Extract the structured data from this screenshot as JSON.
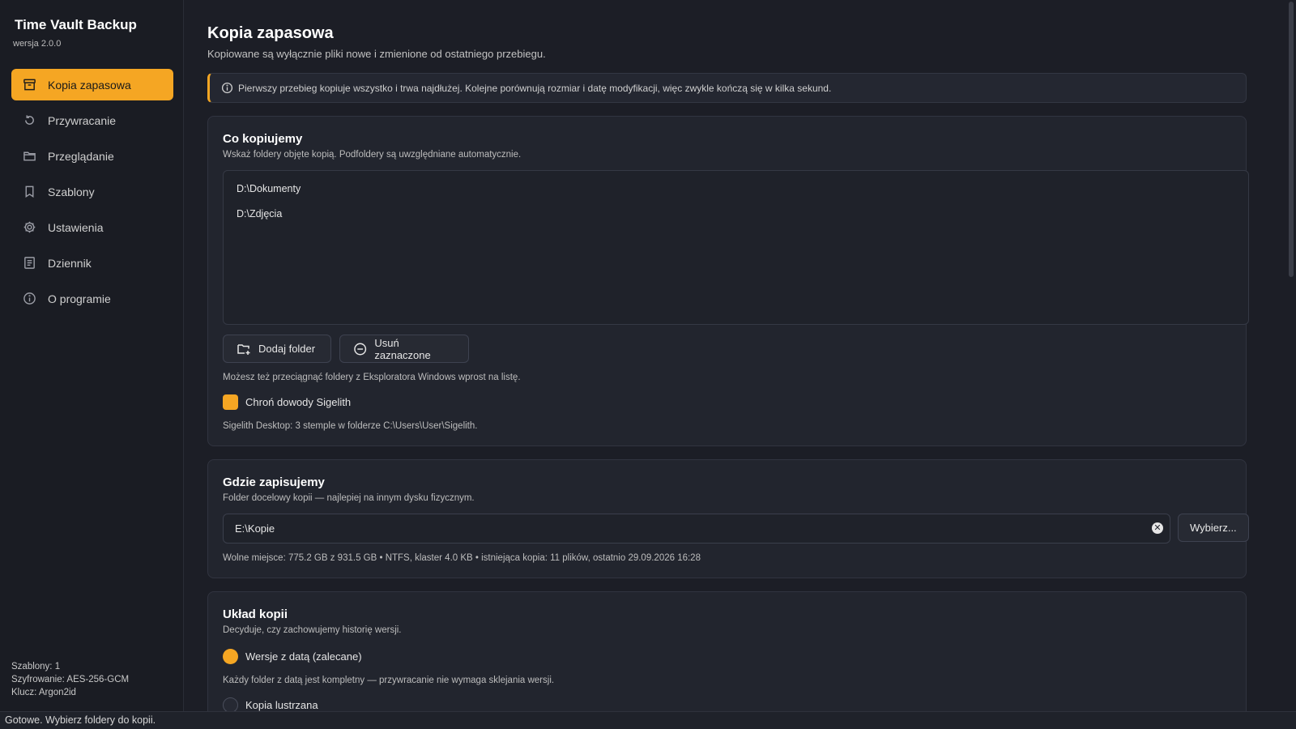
{
  "app": {
    "title": "Time Vault Backup",
    "version": "wersja 2.0.0",
    "accent_color": "#f5a623"
  },
  "sidebar": {
    "items": [
      {
        "label": "Kopia zapasowa",
        "icon": "archive-icon",
        "active": true
      },
      {
        "label": "Przywracanie",
        "icon": "restore-icon",
        "active": false
      },
      {
        "label": "Przeglądanie",
        "icon": "folder-icon",
        "active": false
      },
      {
        "label": "Szablony",
        "icon": "bookmark-icon",
        "active": false
      },
      {
        "label": "Ustawienia",
        "icon": "gear-icon",
        "active": false
      },
      {
        "label": "Dziennik",
        "icon": "log-icon",
        "active": false
      },
      {
        "label": "O programie",
        "icon": "info-icon",
        "active": false
      }
    ],
    "footer": {
      "templates": "Szablony: 1",
      "encryption": "Szyfrowanie: AES-256-GCM",
      "key": "Klucz: Argon2id"
    }
  },
  "page": {
    "title": "Kopia zapasowa",
    "subtitle": "Kopiowane są wyłącznie pliki nowe i zmienione od ostatniego przebiegu.",
    "notice": "Pierwszy przebieg kopiuje wszystko i trwa najdłużej. Kolejne porównują rozmiar i datę modyfikacji, więc zwykle kończą się w kilka sekund."
  },
  "source_card": {
    "title": "Co kopiujemy",
    "description": "Wskaż foldery objęte kopią. Podfoldery są uwzględniane automatycznie.",
    "folders": [
      "D:\\Dokumenty",
      "D:\\Zdjęcia"
    ],
    "add_button": "Dodaj folder",
    "remove_button": "Usuń zaznaczone",
    "drag_hint": "Możesz też przeciągnąć foldery z Eksploratora Windows wprost na listę.",
    "protect_checkbox": {
      "label": "Chroń dowody Sigelith",
      "checked": true
    },
    "sigelith_info": "Sigelith Desktop: 3 stemple w folderze C:\\Users\\User\\Sigelith."
  },
  "destination_card": {
    "title": "Gdzie zapisujemy",
    "description": "Folder docelowy kopii — najlepiej na innym dysku fizycznym.",
    "path_value": "E:\\Kopie",
    "choose_button": "Wybierz...",
    "disk_info": "Wolne miejsce: 775.2 GB z 931.5 GB • NTFS, klaster 4.0 KB • istniejąca kopia: 11 plików, ostatnio 29.09.2026 16:28"
  },
  "layout_card": {
    "title": "Układ kopii",
    "description": "Decyduje, czy zachowujemy historię wersji.",
    "options": [
      {
        "label": "Wersje z datą (zalecane)",
        "selected": true,
        "note": "Każdy folder z datą jest kompletny — przywracanie nie wymaga sklejania wersji."
      },
      {
        "label": "Kopia lustrzana",
        "selected": false
      }
    ]
  },
  "status": {
    "text": "Gotowe. Wybierz foldery do kopii."
  }
}
